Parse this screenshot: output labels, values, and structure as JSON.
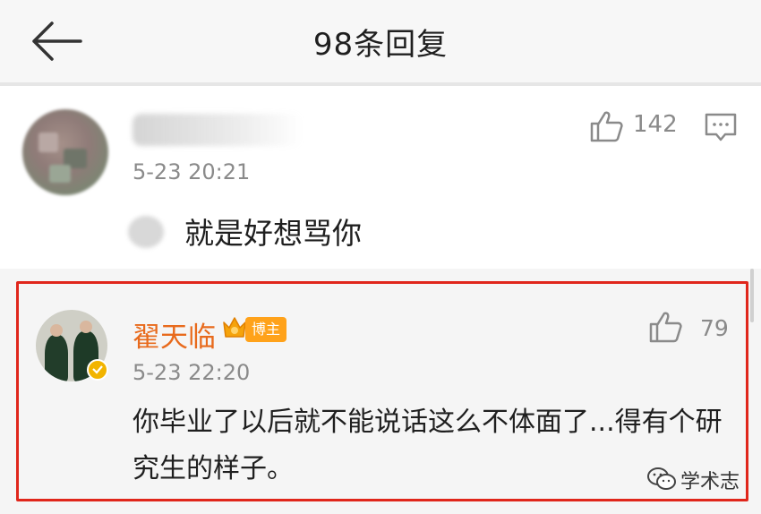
{
  "header": {
    "title": "98条回复"
  },
  "comments": [
    {
      "time": "5-23 20:21",
      "likes": "142",
      "text": "就是好想骂你"
    },
    {
      "username": "翟天临",
      "badge": "博主",
      "time": "5-23 22:20",
      "likes": "79",
      "text": "你毕业了以后就不能说话这么不体面了...得有个研究生的样子。",
      "highlight_color": "#e0261b"
    }
  ],
  "watermark": {
    "text": "学术志"
  },
  "icons": [
    "back-arrow-icon",
    "thumbs-up-icon",
    "reply-comment-icon",
    "crown-icon",
    "verified-badge-icon",
    "wechat-logo-icon"
  ]
}
